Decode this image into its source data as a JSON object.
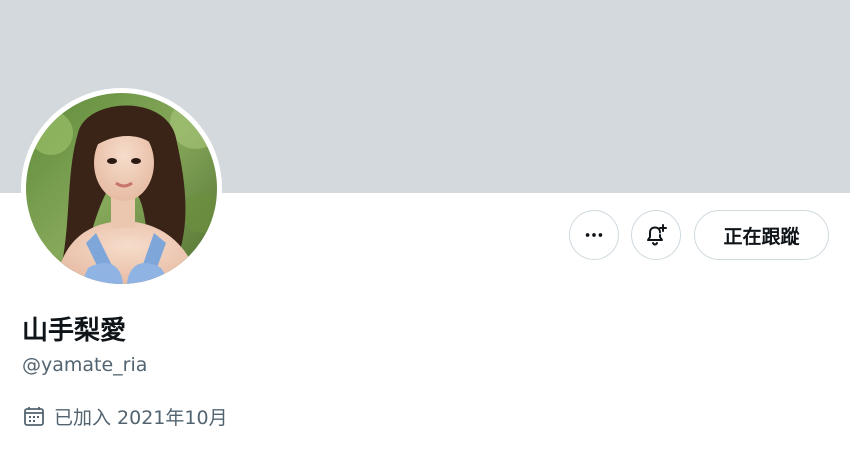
{
  "profile": {
    "display_name": "山手梨愛",
    "handle": "@yamate_ria",
    "joined": "已加入 2021年10月"
  },
  "actions": {
    "more_icon": "more-horizontal-icon",
    "notify_icon": "bell-plus-icon",
    "following_label": "正在跟蹤"
  },
  "icons": {
    "calendar": "calendar-icon"
  },
  "colors": {
    "banner": "#d4d9dd",
    "text_primary": "#0f1419",
    "text_secondary": "#536471",
    "button_border": "#cfd9de"
  }
}
